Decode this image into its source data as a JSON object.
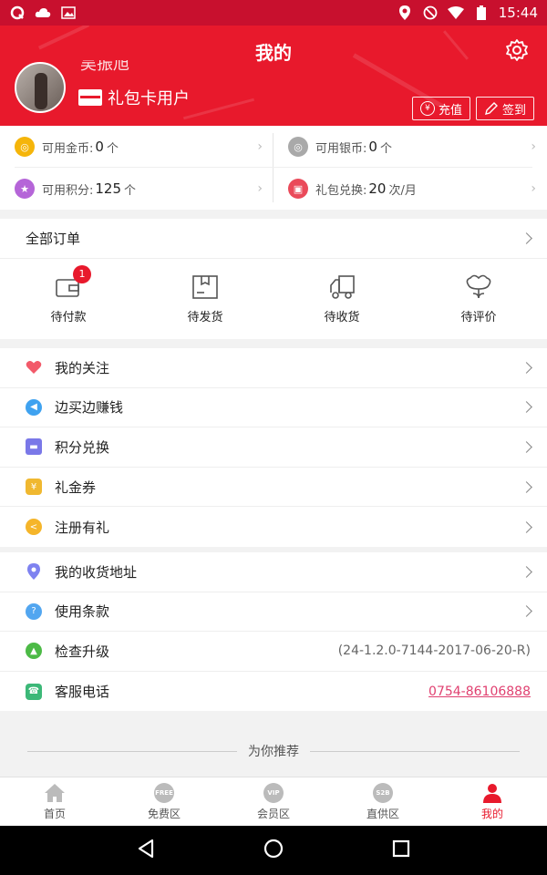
{
  "status_bar": {
    "time": "15:44",
    "icons": [
      "app-q-icon",
      "cloud-icon",
      "image-icon",
      "location-icon",
      "do-not-disturb-icon",
      "wifi-icon",
      "battery-icon"
    ]
  },
  "header": {
    "title": "我的",
    "username": "吴振旭",
    "user_type": "礼包卡用户",
    "recharge_label": "充值",
    "signin_label": "签到",
    "bg_color": "#e8192c"
  },
  "wallet": {
    "gold": {
      "label": "可用金币:",
      "value": "0",
      "unit": "个"
    },
    "silver": {
      "label": "可用银币:",
      "value": "0",
      "unit": "个"
    },
    "points": {
      "label": "可用积分:",
      "value": "125",
      "unit": "个"
    },
    "gift": {
      "label": "礼包兑换:",
      "value": "20",
      "unit": "次/月"
    }
  },
  "orders": {
    "title": "全部订单",
    "items": [
      {
        "label": "待付款",
        "badge": "1"
      },
      {
        "label": "待发货"
      },
      {
        "label": "待收货"
      },
      {
        "label": "待评价"
      }
    ]
  },
  "menu1": [
    {
      "label": "我的关注",
      "icon": "heart-icon",
      "color": "#f25a6a"
    },
    {
      "label": "边买边赚钱",
      "icon": "megaphone-icon",
      "color": "#3fa2f0"
    },
    {
      "label": "积分兑换",
      "icon": "card-icon",
      "color": "#7a78e8"
    },
    {
      "label": "礼金券",
      "icon": "money-bag-icon",
      "color": "#f0b830"
    },
    {
      "label": "注册有礼",
      "icon": "share-icon",
      "color": "#f5b52a"
    }
  ],
  "menu2": [
    {
      "label": "我的收货地址",
      "icon": "location-pin-icon",
      "color": "#7e82f0"
    },
    {
      "label": "使用条款",
      "icon": "question-icon",
      "color": "#52a6f0"
    },
    {
      "label": "检查升级",
      "icon": "upgrade-arrow-icon",
      "color": "#4cba46",
      "value": "(24-1.2.0-7144-2017-06-20-R)"
    },
    {
      "label": "客服电话",
      "icon": "phone-icon",
      "color": "#3cb878",
      "value": "0754-86106888"
    }
  ],
  "recommend_title": "为你推荐",
  "tabs": [
    {
      "label": "首页",
      "icon_text": ""
    },
    {
      "label": "免费区",
      "icon_text": "FREE"
    },
    {
      "label": "会员区",
      "icon_text": "VIP"
    },
    {
      "label": "直供区",
      "icon_text": "S2B"
    },
    {
      "label": "我的",
      "icon_text": ""
    }
  ]
}
